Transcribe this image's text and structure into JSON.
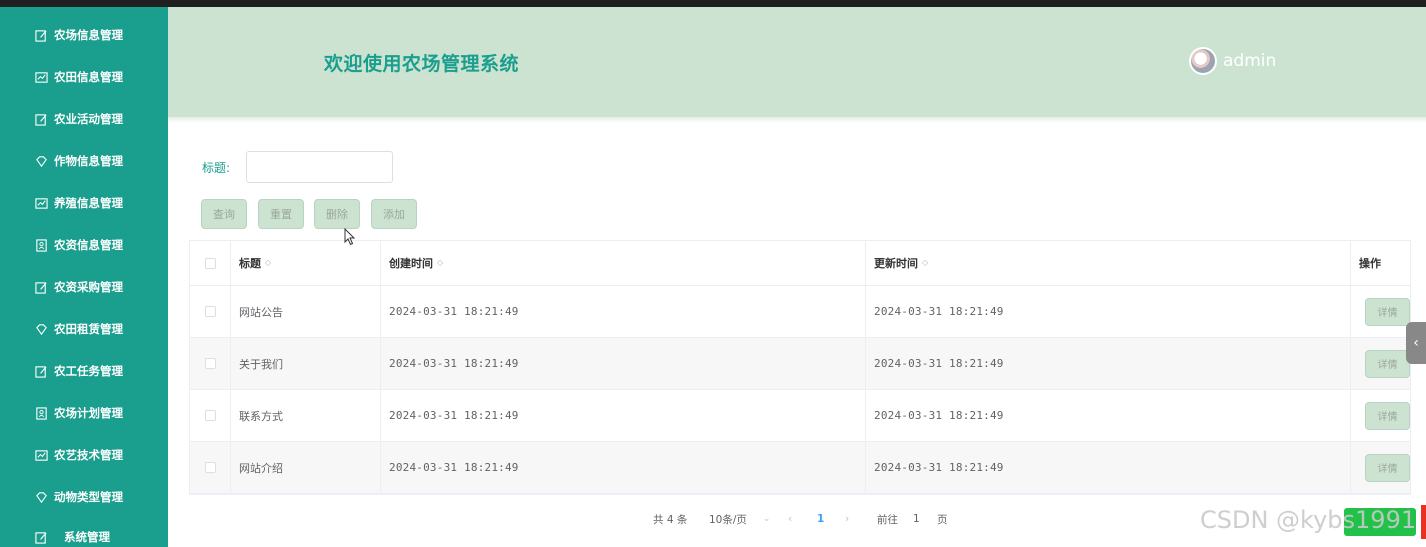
{
  "sidebar": {
    "items": [
      {
        "label": "农场信息管理",
        "icon": "edit-icon"
      },
      {
        "label": "农田信息管理",
        "icon": "chart-icon"
      },
      {
        "label": "农业活动管理",
        "icon": "edit-icon"
      },
      {
        "label": "作物信息管理",
        "icon": "diamond-icon"
      },
      {
        "label": "养殖信息管理",
        "icon": "chart-icon"
      },
      {
        "label": "农资信息管理",
        "icon": "id-card-icon"
      },
      {
        "label": "农资采购管理",
        "icon": "edit-icon"
      },
      {
        "label": "农田租赁管理",
        "icon": "diamond-icon"
      },
      {
        "label": "农工任务管理",
        "icon": "edit-icon"
      },
      {
        "label": "农场计划管理",
        "icon": "id-card-icon"
      },
      {
        "label": "农艺技术管理",
        "icon": "chart-icon"
      },
      {
        "label": "动物类型管理",
        "icon": "diamond-icon"
      },
      {
        "label": "系统管理",
        "icon": "edit-icon"
      }
    ]
  },
  "header": {
    "title": "欢迎使用农场管理系统",
    "username": "admin"
  },
  "filter": {
    "label": "标题:",
    "value": ""
  },
  "toolbar": {
    "query": "查询",
    "reset": "重置",
    "delete": "删除",
    "add": "添加"
  },
  "table": {
    "columns": [
      "标题",
      "创建时间",
      "更新时间",
      "操作"
    ],
    "sort_icon": "◇",
    "detail_label": "详情",
    "rows": [
      {
        "title": "网站公告",
        "created": "2024-03-31 18:21:49",
        "updated": "2024-03-31 18:21:49"
      },
      {
        "title": "关于我们",
        "created": "2024-03-31 18:21:49",
        "updated": "2024-03-31 18:21:49"
      },
      {
        "title": "联系方式",
        "created": "2024-03-31 18:21:49",
        "updated": "2024-03-31 18:21:49"
      },
      {
        "title": "网站介绍",
        "created": "2024-03-31 18:21:49",
        "updated": "2024-03-31 18:21:49"
      }
    ]
  },
  "pagination": {
    "total": "共 4 条",
    "page_size": "10条/页",
    "current_page": "1",
    "goto_prefix": "前往",
    "goto_value": "1",
    "goto_suffix": "页"
  },
  "watermark": "CSDN @kybs1991",
  "colors": {
    "sidebar": "#1a9e8e",
    "header": "#cde3d1",
    "accent": "#1a9e8e",
    "button": "#cde3d1"
  }
}
